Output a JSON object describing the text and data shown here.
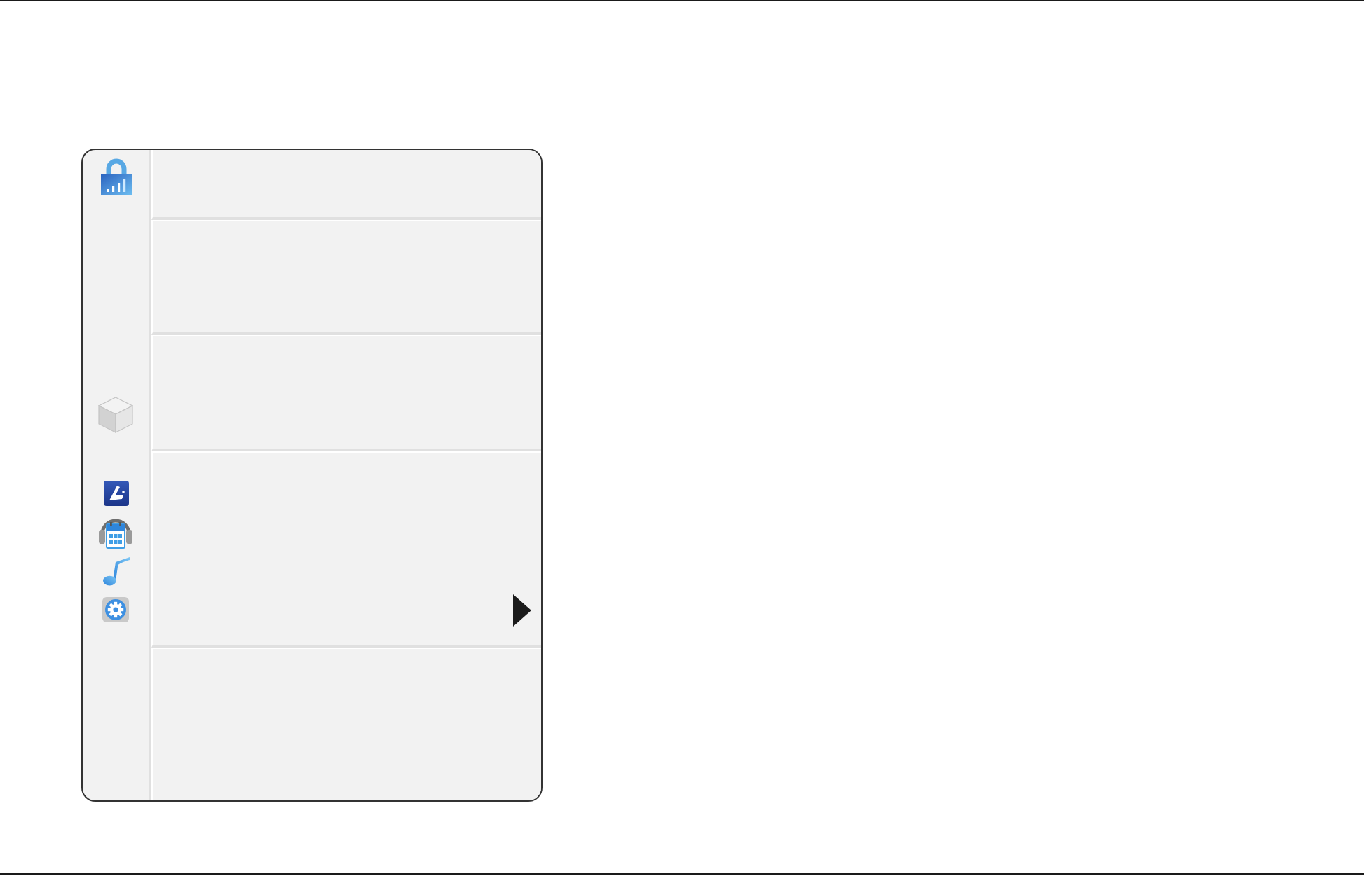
{
  "menu": {
    "sections": [
      {
        "submenu": false
      },
      {
        "submenu": false
      },
      {
        "submenu": false
      },
      {
        "submenu": true
      },
      {
        "submenu": false
      }
    ]
  }
}
